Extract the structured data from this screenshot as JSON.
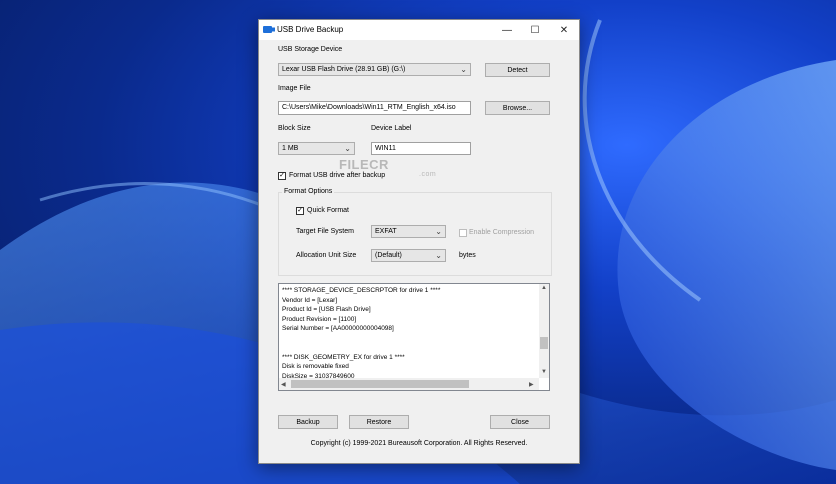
{
  "window": {
    "title": "USB Drive Backup"
  },
  "titlebar": {
    "minimize": "—",
    "maximize": "☐",
    "close": "✕"
  },
  "device": {
    "label": "USB Storage Device",
    "selected": "Lexar USB Flash Drive (28.91 GB) (G:\\)",
    "detect_label": "Detect"
  },
  "image_file": {
    "label": "Image File",
    "value": "C:\\Users\\Mike\\Downloads\\Win11_RTM_English_x64.iso",
    "browse_label": "Browse..."
  },
  "block_size": {
    "label": "Block Size",
    "selected": "1 MB"
  },
  "device_label": {
    "label": "Device Label",
    "value": "WIN11"
  },
  "format_after": {
    "label": "Format USB drive after backup",
    "checked": true
  },
  "format_options": {
    "title": "Format Options",
    "quick_format": {
      "label": "Quick Format",
      "checked": true
    },
    "file_system": {
      "label": "Target File System",
      "selected": "EXFAT"
    },
    "compression": {
      "label": "Enable Compression",
      "checked": false
    },
    "alloc_unit": {
      "label": "Allocation Unit Size",
      "selected": "(Default)",
      "unit": "bytes"
    }
  },
  "log": {
    "lines": [
      "**** STORAGE_DEVICE_DESCRPTOR for drive 1 ****",
      "Vendor Id = [Lexar]",
      "Product Id = [USB Flash Drive]",
      "Product Revision = [1100]",
      "Serial Number = [AA00000000004098]",
      "",
      "",
      "**** DISK_GEOMETRY_EX for drive 1 ****",
      "Disk is removable fixed",
      "DiskSize = 31037849600"
    ]
  },
  "actions": {
    "backup": "Backup",
    "restore": "Restore",
    "close": "Close"
  },
  "footer": {
    "copyright": "Copyright (c) 1999-2021 Bureausoft Corporation. All Rights Reserved."
  },
  "watermark": {
    "brand": "FILECR",
    "suffix": ".com"
  }
}
